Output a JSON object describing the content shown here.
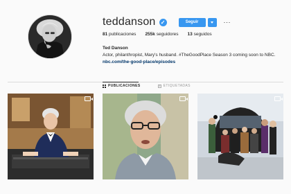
{
  "profile": {
    "username": "teddanson",
    "verified_glyph": "✓",
    "follow_label": "Seguir",
    "more_label": "···",
    "stats": {
      "posts_count": "81",
      "posts_label": "publicaciones",
      "followers_count": "255k",
      "followers_label": "seguidores",
      "following_count": "13",
      "following_label": "seguidos"
    },
    "full_name": "Ted Danson",
    "bio": "Actor, philanthropist, Mary's husband. #TheGoodPlace Season 3 coming soon to NBC.",
    "link": "nbc.com/the-good-place/episodes"
  },
  "tabs": [
    {
      "label": "PUBLICACIONES",
      "icon": "grid-icon",
      "active": true
    },
    {
      "label": "ETIQUETADAS",
      "icon": "tag-icon",
      "active": false
    }
  ],
  "posts": [
    {
      "icon": "video-icon"
    },
    {
      "icon": "video-icon"
    },
    {
      "icon": "video-icon"
    }
  ],
  "colors": {
    "accent": "#3897f0",
    "link": "#003569",
    "background": "#fafafa",
    "divider": "#dbdbdb"
  }
}
